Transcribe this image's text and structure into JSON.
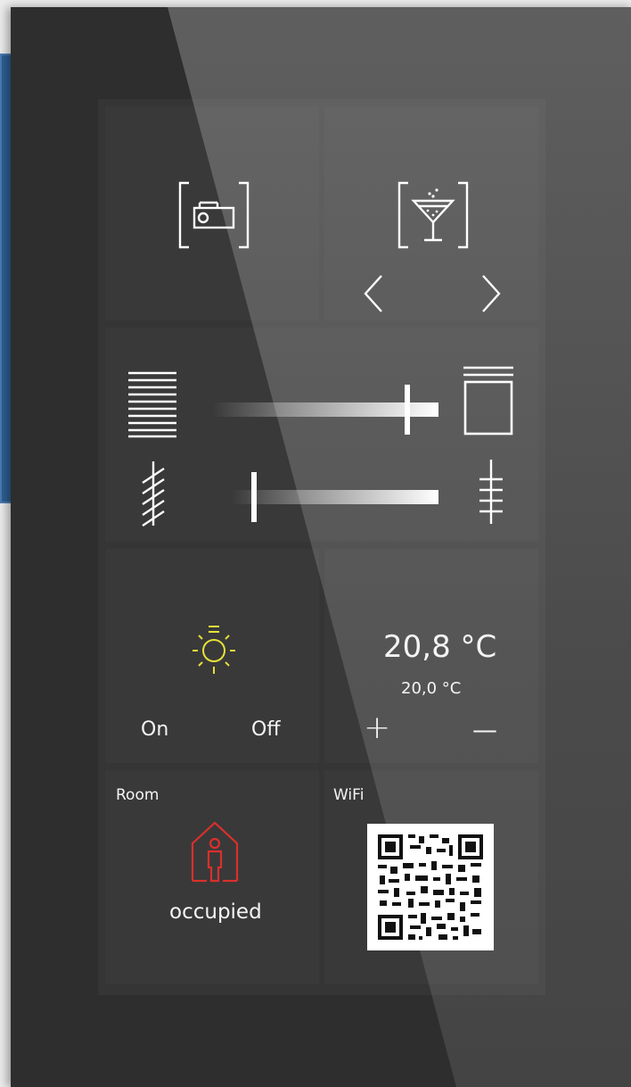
{
  "scenes": {
    "left_icon": "projector-icon",
    "right_icon": "cocktail-icon",
    "prev_icon": "chevron-left-icon",
    "next_icon": "chevron-right-icon"
  },
  "blinds": {
    "position_slider": {
      "left_icon": "blinds-closed-icon",
      "right_icon": "blinds-open-icon",
      "value_percent": 85
    },
    "tilt_slider": {
      "left_icon": "slats-tilted-icon",
      "right_icon": "slats-open-icon",
      "value_percent": 5
    }
  },
  "light": {
    "icon": "light-bulb-icon",
    "icon_color": "#e6e03a",
    "on_label": "On",
    "off_label": "Off"
  },
  "climate": {
    "current_temp": "20,8 °C",
    "setpoint": "20,0 °C",
    "plus_label": "+",
    "minus_label": "—"
  },
  "room": {
    "label": "Room",
    "icon": "house-person-icon",
    "icon_color": "#d9302c",
    "status": "occupied"
  },
  "wifi": {
    "label": "WiFi",
    "icon": "qr-code-icon"
  }
}
